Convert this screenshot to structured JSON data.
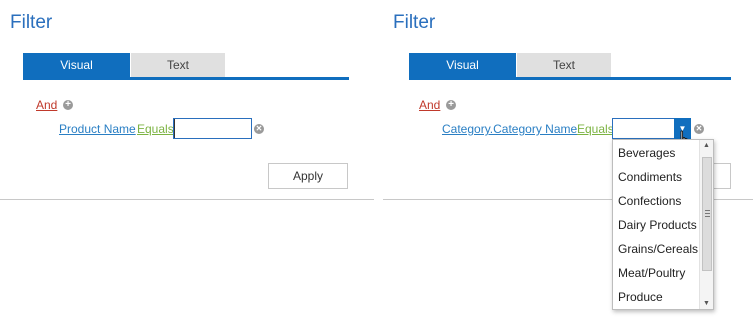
{
  "left_panel": {
    "title": "Filter",
    "tabs": [
      {
        "label": "Visual"
      },
      {
        "label": "Text"
      }
    ],
    "group_operator": "And",
    "condition": {
      "field": "Product Name",
      "operator": "Equals",
      "value": ""
    },
    "apply_label": "Apply"
  },
  "right_panel": {
    "title": "Filter",
    "tabs": [
      {
        "label": "Visual"
      },
      {
        "label": "Text"
      }
    ],
    "group_operator": "And",
    "condition": {
      "field": "Category.Category Name",
      "operator": "Equals",
      "value": ""
    },
    "dropdown_options": [
      "Beverages",
      "Condiments",
      "Confections",
      "Dairy Products",
      "Grains/Cereals",
      "Meat/Poultry",
      "Produce"
    ]
  },
  "colors": {
    "accent": "#106ebe",
    "title": "#2a6fbd",
    "group_operator": "#c0392b",
    "field_link": "#2a7fc4",
    "operator_link": "#7cb342"
  },
  "icons": [
    "add-condition-icon",
    "remove-condition-icon",
    "dropdown-arrow-icon",
    "hand-cursor-icon",
    "scroll-up-icon",
    "scroll-down-icon"
  ]
}
